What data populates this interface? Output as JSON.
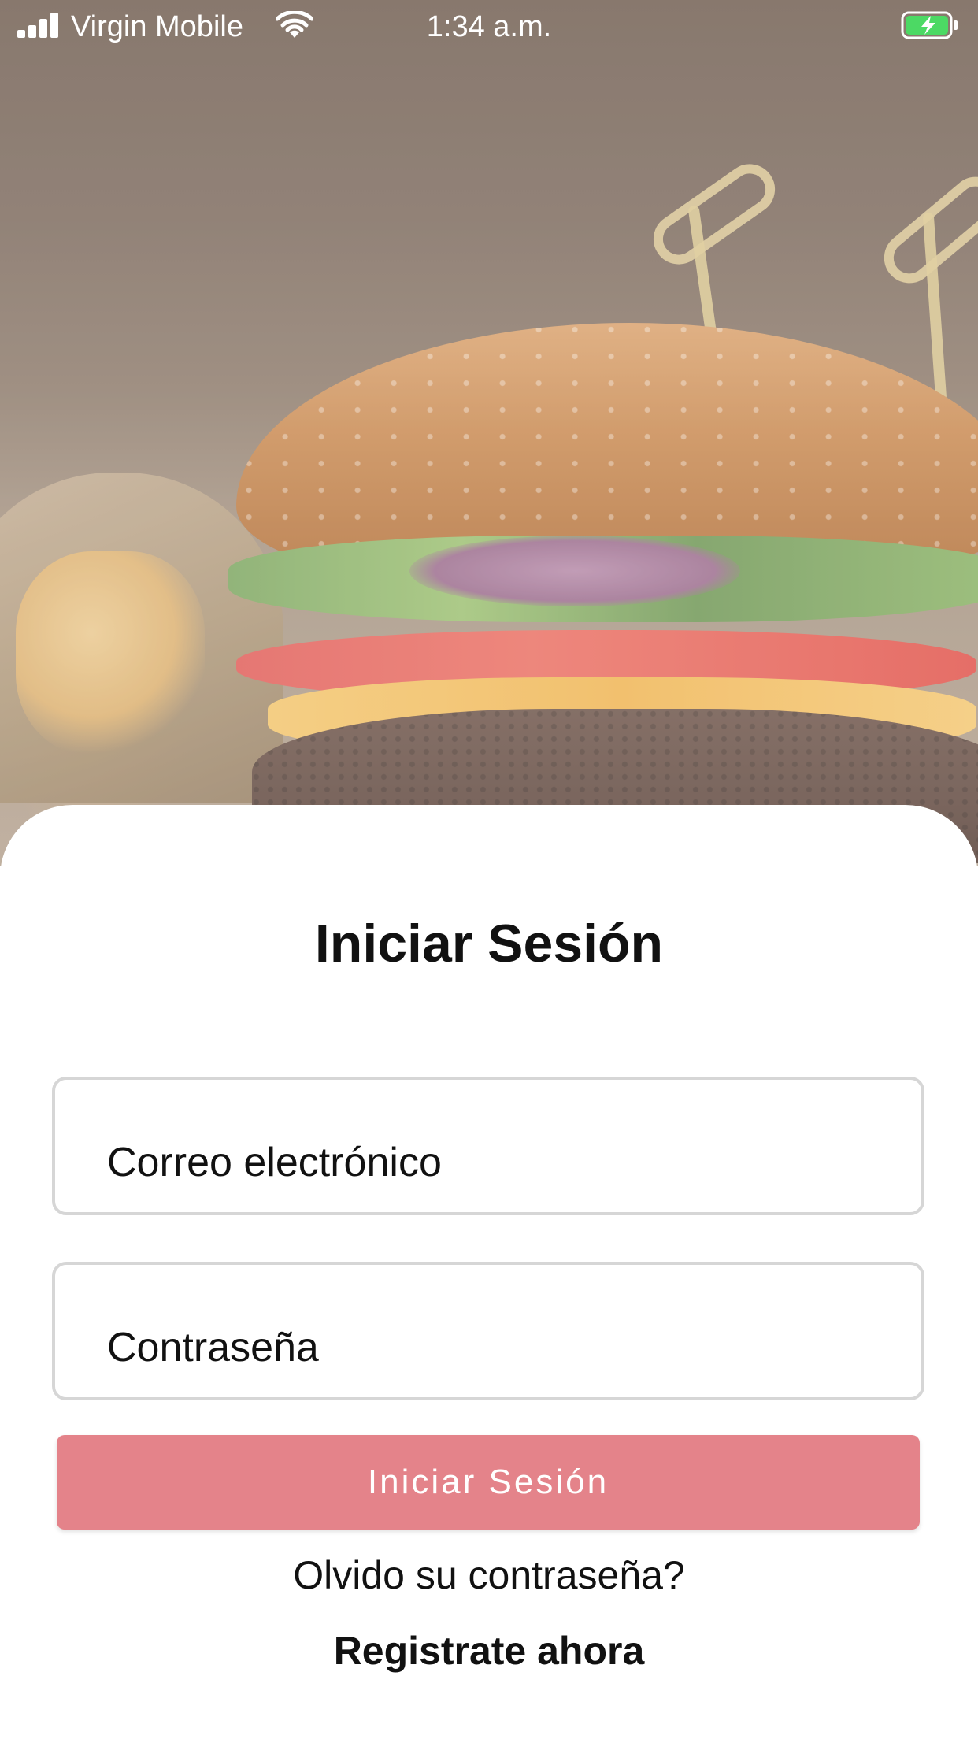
{
  "status_bar": {
    "carrier": "Virgin Mobile",
    "time": "1:34 a.m.",
    "signal_icon": "signal-bars-icon",
    "wifi_icon": "wifi-icon",
    "battery_icon": "battery-charging-icon",
    "battery_color": "#4cd964"
  },
  "hero": {
    "image": "burger-photo"
  },
  "login": {
    "title": "Iniciar Sesión",
    "email_placeholder": "Correo electrónico",
    "password_placeholder": "Contraseña",
    "submit_label": "Iniciar Sesión",
    "forgot_label": "Olvido su contraseña?",
    "register_label": "Registrate ahora",
    "accent_color": "#e4838a"
  }
}
